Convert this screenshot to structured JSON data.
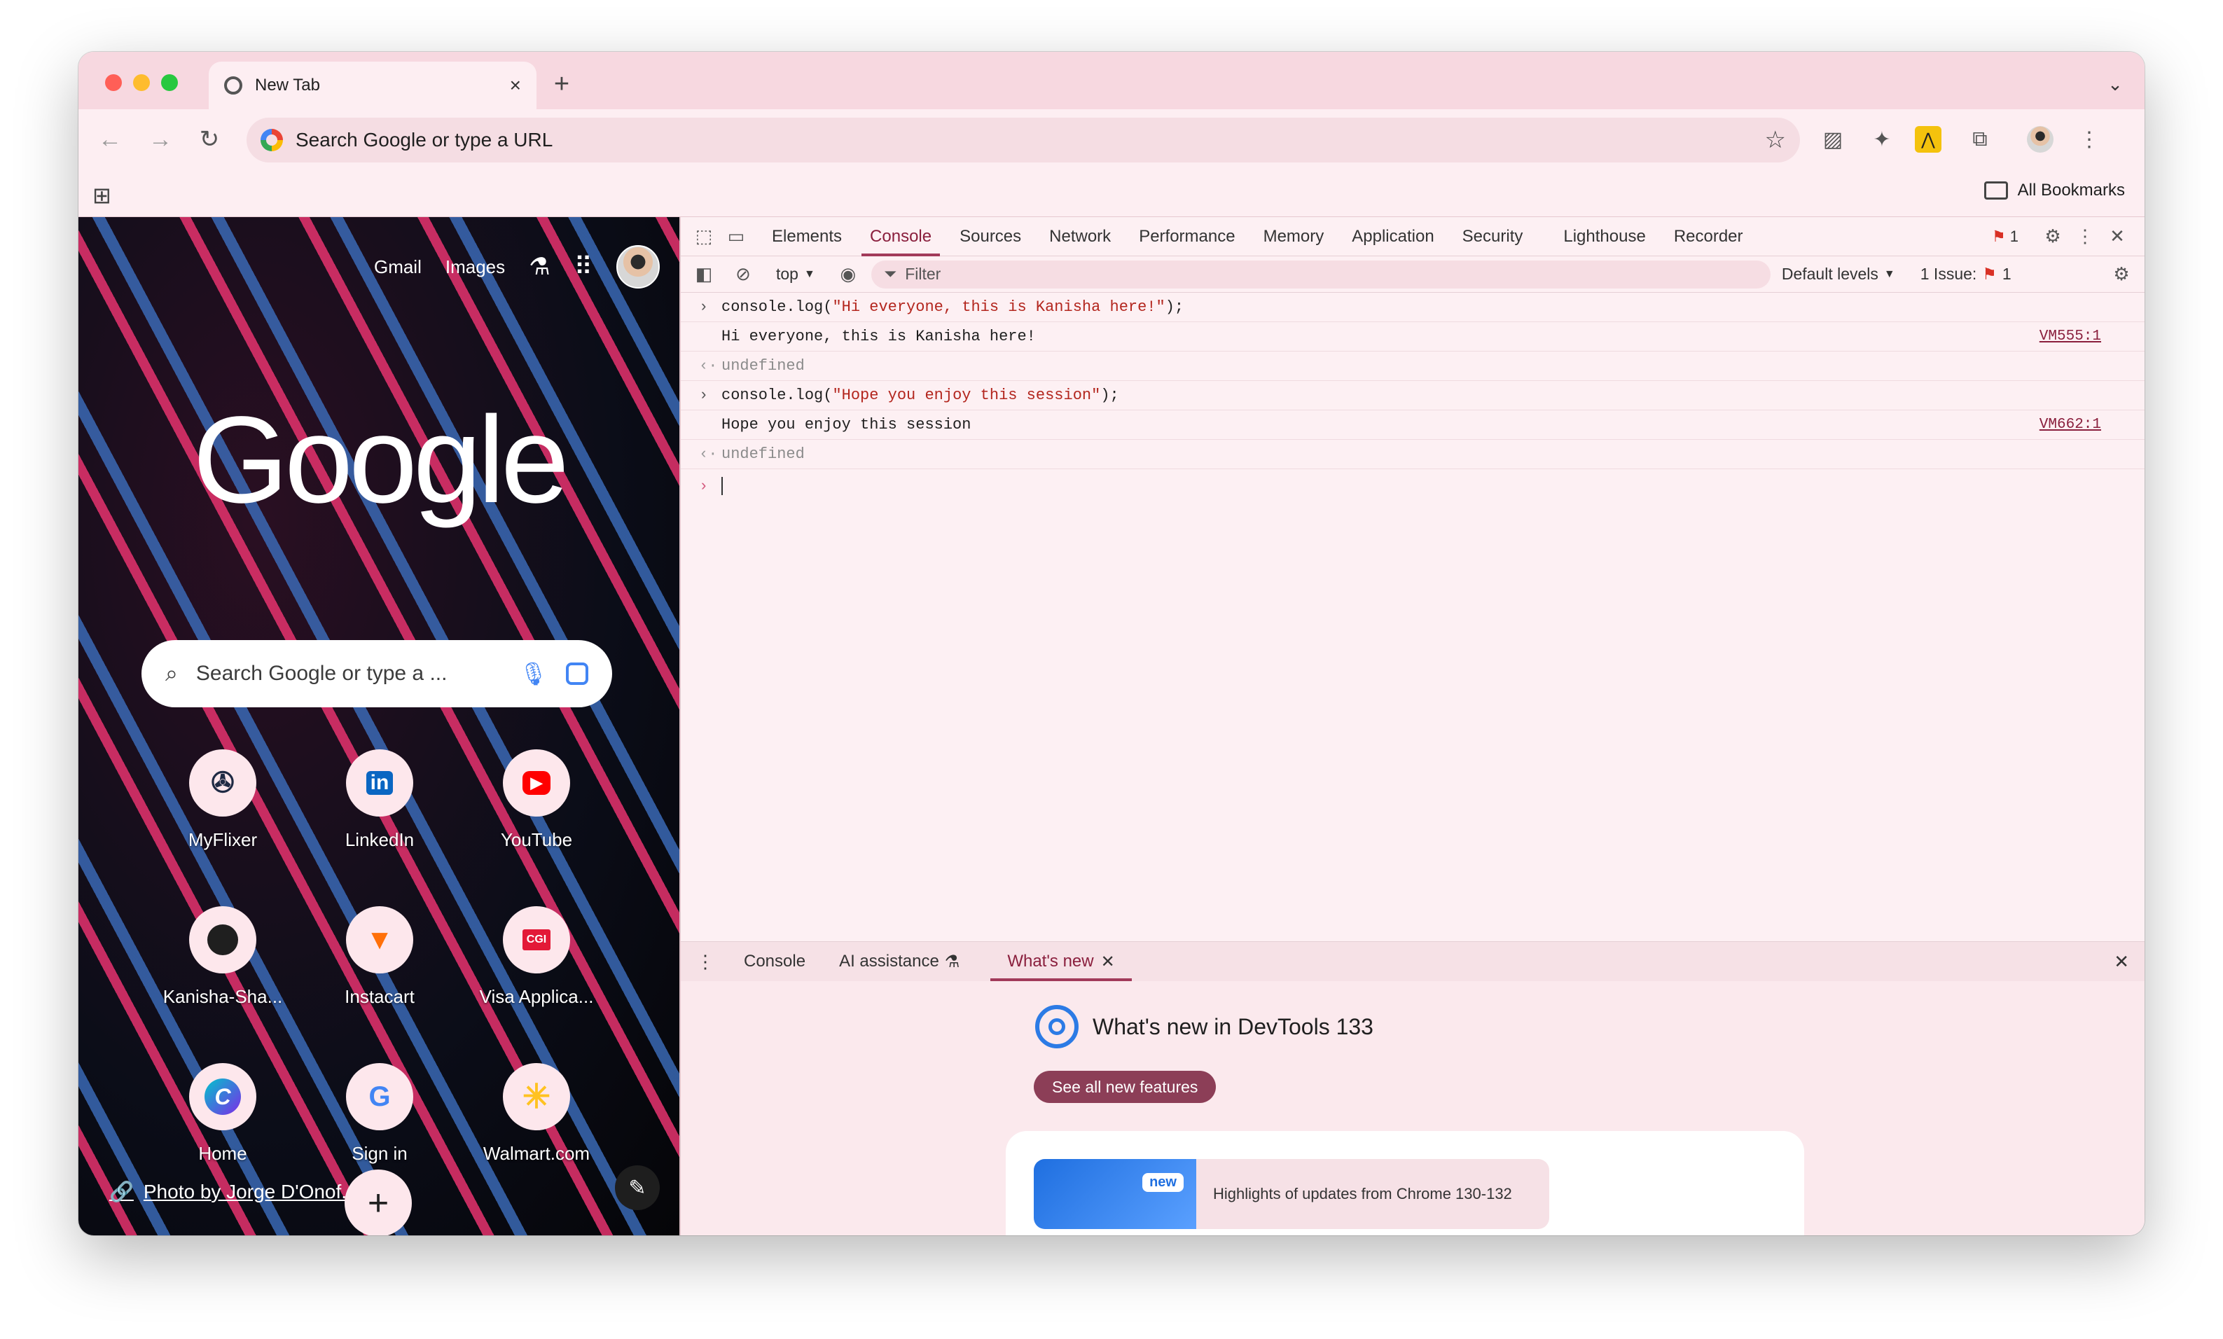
{
  "browser": {
    "tab_title": "New Tab",
    "omnibox_placeholder": "Search Google or type a URL",
    "all_bookmarks_label": "All Bookmarks"
  },
  "ntp": {
    "top_links": {
      "gmail": "Gmail",
      "images": "Images"
    },
    "logo_text": "Google",
    "search_placeholder": "Search Google or type a ...",
    "shortcuts": [
      {
        "label": "MyFlixer",
        "icon": "film-reel-icon"
      },
      {
        "label": "LinkedIn",
        "icon": "linkedin-icon"
      },
      {
        "label": "YouTube",
        "icon": "youtube-icon"
      },
      {
        "label": "Kanisha-Sha...",
        "icon": "github-icon"
      },
      {
        "label": "Instacart",
        "icon": "carrot-icon"
      },
      {
        "label": "Visa Applica...",
        "icon": "cgi-icon"
      },
      {
        "label": "Home",
        "icon": "canva-icon"
      },
      {
        "label": "Sign in",
        "icon": "google-icon"
      },
      {
        "label": "Walmart.com",
        "icon": "walmart-spark-icon"
      }
    ],
    "photo_credit": "Photo by Jorge D'Onof..."
  },
  "devtools": {
    "panels": [
      "Elements",
      "Console",
      "Sources",
      "Network",
      "Performance",
      "Memory",
      "Application",
      "Security",
      "Lighthouse",
      "Recorder"
    ],
    "active_panel": "Console",
    "error_count": "1",
    "context": "top",
    "filter_placeholder": "Filter",
    "levels": "Default levels",
    "issues_label": "1 Issue:",
    "issues_count": "1",
    "console_lines": [
      {
        "type": "input",
        "code_pre": "console.log(",
        "code_str": "\"Hi everyone, this is Kanisha here!\"",
        "code_post": ");"
      },
      {
        "type": "output",
        "text": "Hi everyone, this is Kanisha here!",
        "source": "VM555:1"
      },
      {
        "type": "return",
        "text": "undefined"
      },
      {
        "type": "input",
        "code_pre": "console.log(",
        "code_str": "\"Hope you enjoy this session\"",
        "code_post": ");"
      },
      {
        "type": "output",
        "text": "Hope you enjoy this session",
        "source": "VM662:1"
      },
      {
        "type": "return",
        "text": "undefined"
      }
    ],
    "drawer": {
      "tabs": {
        "console": "Console",
        "ai": "AI assistance",
        "whats_new": "What's new"
      },
      "whats_new_title": "What's new in DevTools 133",
      "see_all_button": "See all new features",
      "highlight_badge": "new",
      "highlight_text": "Highlights of updates from Chrome 130-132"
    }
  },
  "colors": {
    "accent": "#8a1f3d",
    "tab_strip": "#f7d8e0",
    "toolbar": "#fdeef2"
  }
}
